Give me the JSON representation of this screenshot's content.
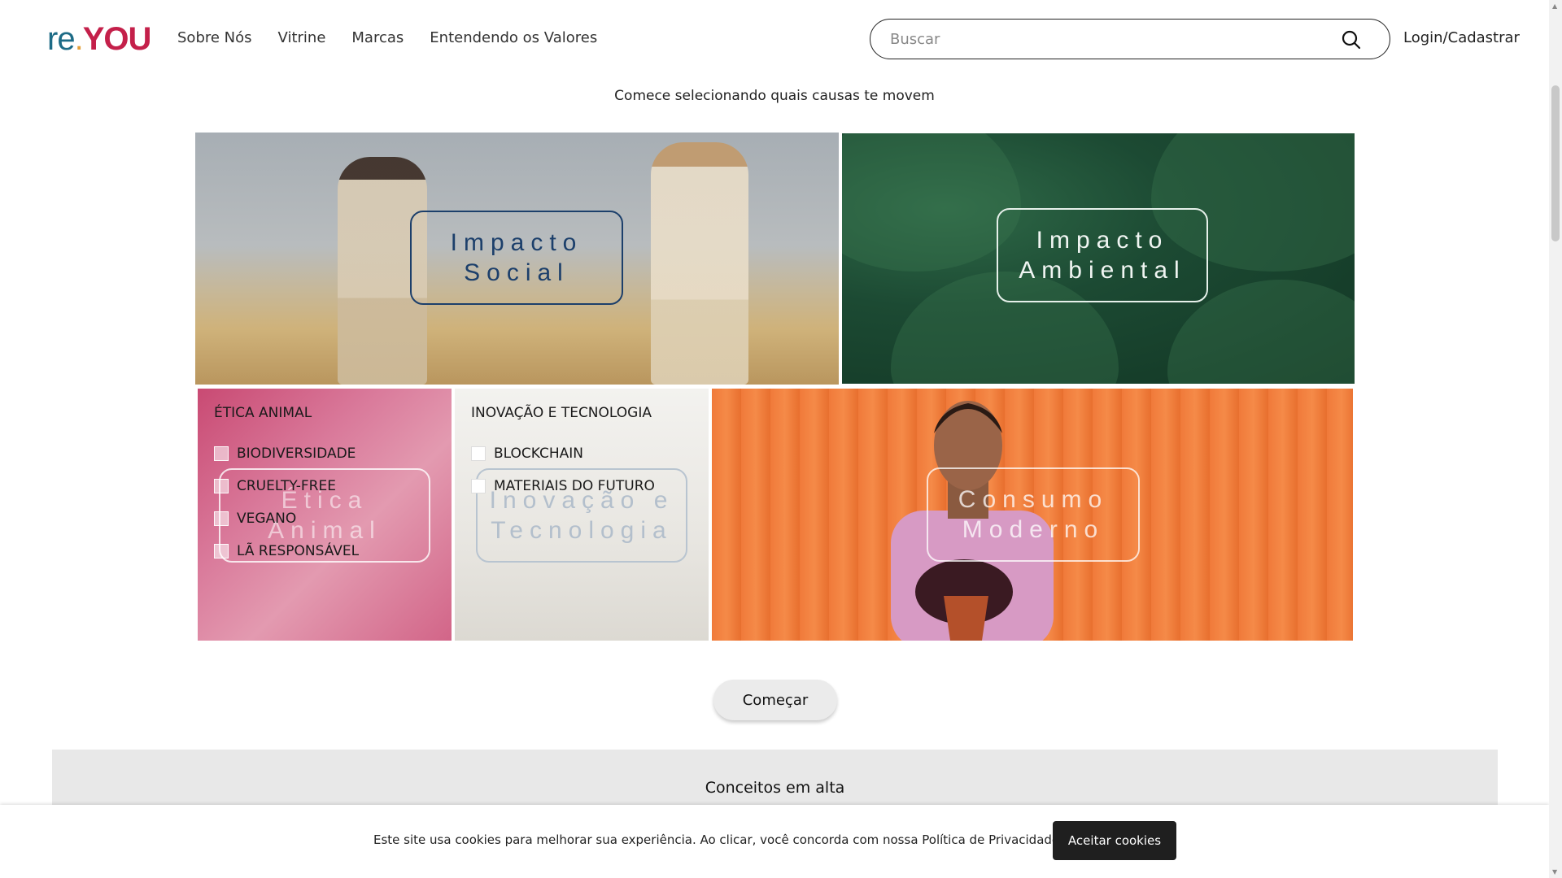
{
  "logo": {
    "re": "re",
    "dot": ".",
    "you": "YOU"
  },
  "nav": [
    "Sobre Nós",
    "Vitrine",
    "Marcas",
    "Entendendo os Valores"
  ],
  "search": {
    "placeholder": "Buscar"
  },
  "login": "Login/Cadastrar",
  "subtitle": "Comece selecionando quais causas te movem",
  "tiles": {
    "social": "Impacto\nSocial",
    "ambiental": "Impacto\nAmbiental",
    "etica": "Ética\nAnimal",
    "inovacao": "Inovação e\nTecnologia",
    "consumo": "Consumo\nModerno"
  },
  "etica_list": {
    "heading": "ÉTICA ANIMAL",
    "items": [
      "BIODIVERSIDADE",
      "CRUELTY-FREE",
      "VEGANO",
      "LÃ RESPONSÁVEL"
    ]
  },
  "inovacao_list": {
    "heading": "INOVAÇÃO E TECNOLOGIA",
    "items": [
      "BLOCKCHAIN",
      "MATERIAIS DO FUTURO"
    ]
  },
  "start_button": "Começar",
  "trending_title": "Conceitos em alta",
  "cookie": {
    "message": "Este site usa cookies para melhorar sua experiência. Ao clicar, você concorda com nossa Política de Privacidade.",
    "accept": "Aceitar cookies"
  }
}
